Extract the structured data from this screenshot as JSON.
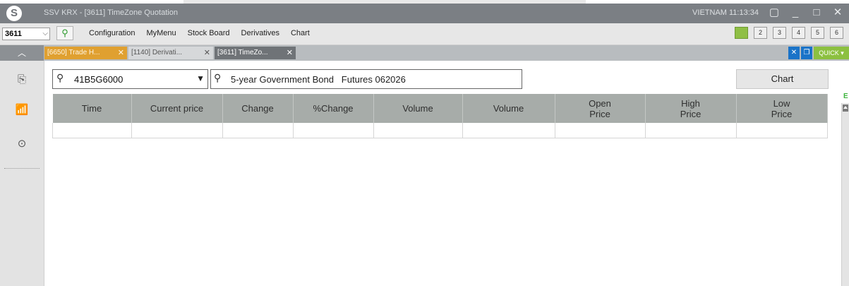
{
  "app": {
    "title": "SSV KRX - [3611] TimeZone Quotation",
    "region_clock": "VIETNAM 11:13:34",
    "window_controls": [
      "▢",
      "_",
      "□",
      "✕"
    ]
  },
  "menubar": {
    "screen_code": "3611",
    "items": [
      "Configuration",
      "MyMenu",
      "Stock Board",
      "Derivatives",
      "Chart"
    ],
    "monitors": [
      "",
      "2",
      "3",
      "4",
      "5",
      "6"
    ]
  },
  "tabs": [
    {
      "label": "[6650] Trade H...",
      "close": "✕"
    },
    {
      "label": "[1140] Derivati...",
      "close": "✕"
    },
    {
      "label": "[3611] TimeZo...",
      "close": "✕"
    }
  ],
  "tab_tools": {
    "close": "✕",
    "restore": "❐",
    "quick": "QUICK ▾"
  },
  "search": {
    "code": "41B5G6000",
    "name": "5-year Government Bond   Futures 062026"
  },
  "chart_button": "Chart",
  "table": {
    "columns": [
      "Time",
      "Current price",
      "Change",
      "%Change",
      "Volume",
      "Volume",
      "Open\nPrice",
      "High\nPrice",
      "Low\nPrice"
    ],
    "rows": [
      [
        "",
        "",
        "",
        "",
        "",
        "",
        "",
        "",
        ""
      ]
    ]
  },
  "scroll_marker": "E",
  "colors": {
    "active_tab": "#e0a030",
    "header_bg": "#a7aca9",
    "quick_button": "#8cc040",
    "close_button": "#1a73c8"
  }
}
